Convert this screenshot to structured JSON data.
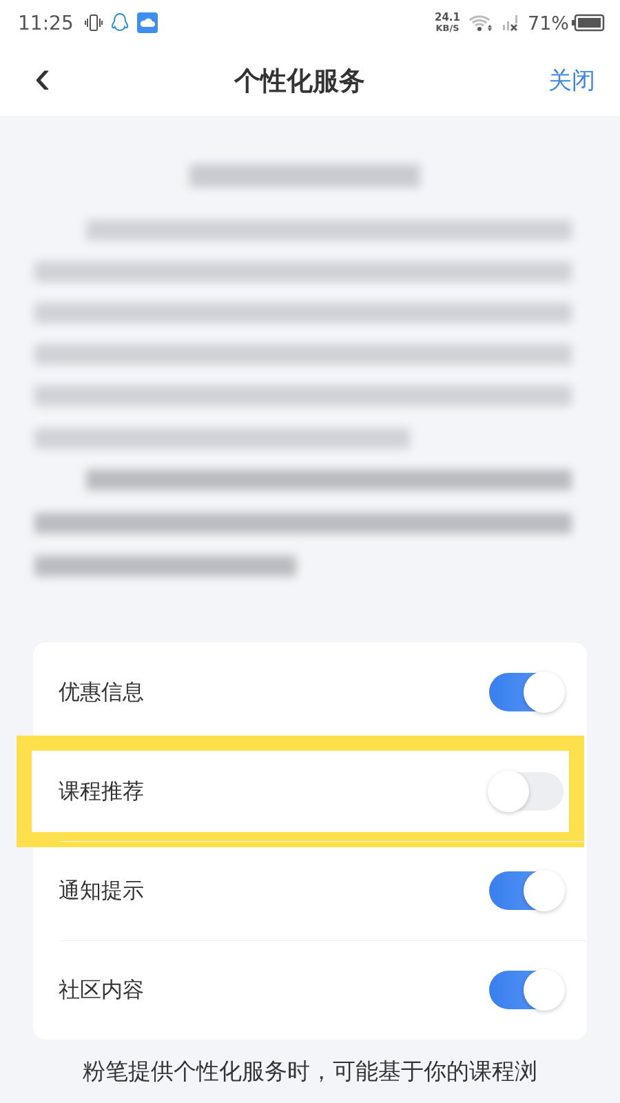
{
  "status_bar": {
    "time": "11:25",
    "net_speed": "24.1",
    "net_unit": "KB/S",
    "battery": "71%"
  },
  "header": {
    "back": "‹",
    "title": "个性化服务",
    "close": "关闭"
  },
  "settings": [
    {
      "label": "优惠信息",
      "on": true,
      "highlighted": false
    },
    {
      "label": "课程推荐",
      "on": false,
      "highlighted": true
    },
    {
      "label": "通知提示",
      "on": true,
      "highlighted": false
    },
    {
      "label": "社区内容",
      "on": true,
      "highlighted": false
    }
  ],
  "footer_text": "粉笔提供个性化服务时，可能基于你的课程浏"
}
